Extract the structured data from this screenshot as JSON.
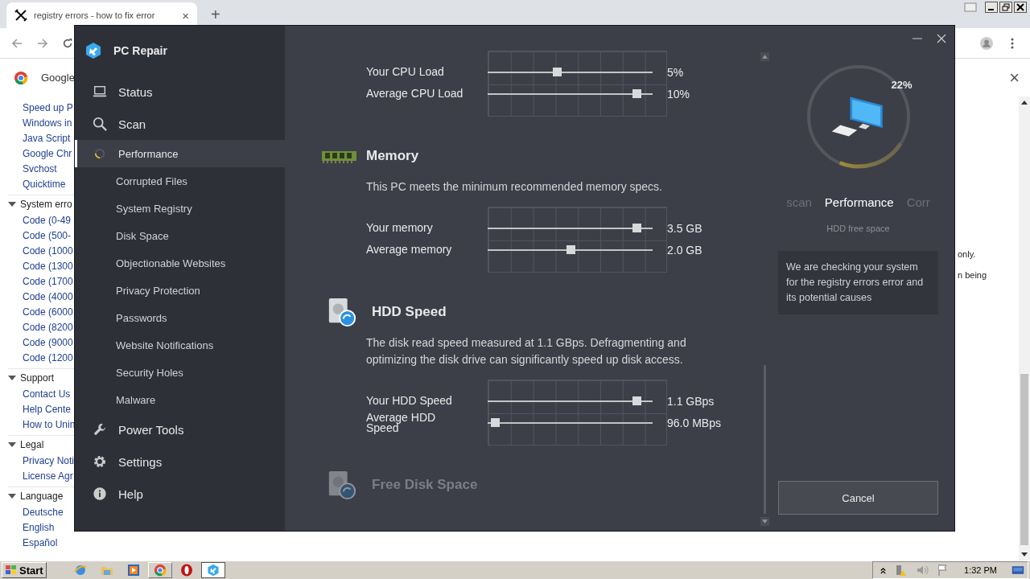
{
  "browser": {
    "tab": {
      "title": "registry errors - how to fix error",
      "close": "×"
    },
    "new_tab": "+",
    "infobar": {
      "label": "Google",
      "close": "×"
    },
    "page_list": [
      {
        "kind": "link",
        "text": "Speed up P"
      },
      {
        "kind": "link",
        "text": "Windows in"
      },
      {
        "kind": "link",
        "text": "Java Script"
      },
      {
        "kind": "link",
        "text": "Google Chr"
      },
      {
        "kind": "link",
        "text": "Svchost"
      },
      {
        "kind": "link",
        "text": "Quicktime"
      },
      {
        "kind": "heading",
        "text": "System erro"
      },
      {
        "kind": "link",
        "text": "Code (0-49"
      },
      {
        "kind": "link",
        "text": "Code (500-"
      },
      {
        "kind": "link",
        "text": "Code (1000"
      },
      {
        "kind": "link",
        "text": "Code (1300"
      },
      {
        "kind": "link",
        "text": "Code (1700"
      },
      {
        "kind": "link",
        "text": "Code (4000"
      },
      {
        "kind": "link",
        "text": "Code (6000"
      },
      {
        "kind": "link",
        "text": "Code (8200"
      },
      {
        "kind": "link",
        "text": "Code (9000"
      },
      {
        "kind": "link",
        "text": "Code (1200"
      },
      {
        "kind": "heading",
        "text": "Support"
      },
      {
        "kind": "link",
        "text": "Contact Us"
      },
      {
        "kind": "link",
        "text": "Help Cente"
      },
      {
        "kind": "link",
        "text": "How to Unin"
      },
      {
        "kind": "heading",
        "text": "Legal"
      },
      {
        "kind": "link",
        "text": "Privacy Noti"
      },
      {
        "kind": "link",
        "text": "License Agr"
      },
      {
        "kind": "heading",
        "text": "Language"
      },
      {
        "kind": "link",
        "text": "Deutsche"
      },
      {
        "kind": "link",
        "text": "English"
      },
      {
        "kind": "link",
        "text": "Español"
      }
    ],
    "page_text": [
      "only.",
      "n being"
    ]
  },
  "app": {
    "title": "PC Repair",
    "nav": [
      {
        "label": "Status",
        "selected": false
      },
      {
        "label": "Scan",
        "selected": false
      },
      {
        "label": "Performance",
        "selected": true,
        "children": [
          {
            "label": "Corrupted Files",
            "selected": false
          },
          {
            "label": "System Registry",
            "selected": false
          },
          {
            "label": "Disk Space",
            "selected": false
          },
          {
            "label": "Objectionable Websites",
            "selected": false
          },
          {
            "label": "Privacy Protection",
            "selected": false
          },
          {
            "label": "Passwords",
            "selected": false
          },
          {
            "label": "Website Notifications",
            "selected": false
          },
          {
            "label": "Security Holes",
            "selected": false
          },
          {
            "label": "Malware",
            "selected": false
          }
        ]
      },
      {
        "label": "Power Tools",
        "selected": false
      },
      {
        "label": "Settings",
        "selected": false
      },
      {
        "label": "Help",
        "selected": false
      }
    ],
    "sections": [
      {
        "metrics": [
          {
            "label": "Your CPU Load",
            "reading": "5%",
            "level": 0.42
          },
          {
            "label": "Average CPU Load",
            "reading": "10%",
            "level": 0.9
          }
        ]
      },
      {
        "title": "Memory",
        "description": "This PC meets the minimum recommended memory specs.",
        "metrics": [
          {
            "label": "Your memory",
            "reading": "3.5 GB",
            "level": 0.9
          },
          {
            "label": "Average memory",
            "reading": "2.0 GB",
            "level": 0.5
          }
        ]
      },
      {
        "title": "HDD Speed",
        "description": "The disk read speed measured at 1.1 GBps. Defragmenting and optimizing the disk drive can significantly speed up disk access.",
        "metrics": [
          {
            "label": "Your HDD Speed",
            "reading": "1.1 GBps",
            "level": 0.9
          },
          {
            "label": "Average HDD Speed",
            "reading": "96.0 MBps",
            "level": 0.045
          }
        ]
      },
      {
        "title": "Free Disk Space",
        "disabled": true
      }
    ],
    "progress": {
      "label": "22%",
      "level": 0.22
    },
    "carousel": [
      {
        "label": "scan",
        "selected": false
      },
      {
        "label": "Performance",
        "selected": true
      },
      {
        "label": "Corr",
        "selected": false
      }
    ],
    "caption": "HDD free space",
    "message": "We are checking your system for the registry errors error and its potential causes",
    "cancel_button": "Cancel"
  },
  "taskbar": {
    "start": "Start",
    "clock": "1:32 PM"
  }
}
